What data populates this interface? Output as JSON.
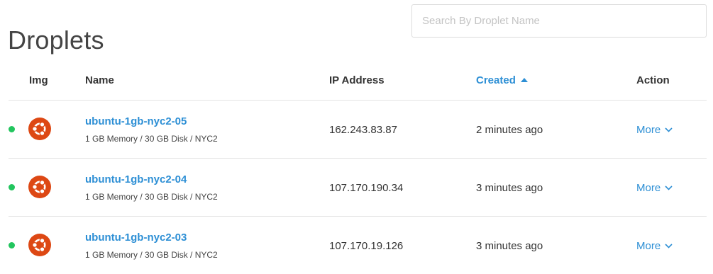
{
  "page": {
    "title": "Droplets"
  },
  "search": {
    "placeholder": "Search By Droplet Name"
  },
  "table": {
    "headers": {
      "img": "Img",
      "name": "Name",
      "ip": "IP Address",
      "created": "Created",
      "action": "Action"
    },
    "sorted_by": "Created",
    "sort_direction": "ascending",
    "rows": [
      {
        "status_color": "#22c55e",
        "icon": "ubuntu-icon",
        "name": "ubuntu-1gb-nyc2-05",
        "specs": "1 GB Memory / 30 GB Disk / NYC2",
        "ip": "162.243.83.87",
        "created": "2 minutes ago",
        "action": "More"
      },
      {
        "status_color": "#22c55e",
        "icon": "ubuntu-icon",
        "name": "ubuntu-1gb-nyc2-04",
        "specs": "1 GB Memory / 30 GB Disk / NYC2",
        "ip": "107.170.190.34",
        "created": "3 minutes ago",
        "action": "More"
      },
      {
        "status_color": "#22c55e",
        "icon": "ubuntu-icon",
        "name": "ubuntu-1gb-nyc2-03",
        "specs": "1 GB Memory / 30 GB Disk / NYC2",
        "ip": "107.170.19.126",
        "created": "3 minutes ago",
        "action": "More"
      }
    ]
  },
  "colors": {
    "link": "#2d8fd5",
    "status_active": "#22c55e",
    "ubuntu": "#dd4814"
  }
}
